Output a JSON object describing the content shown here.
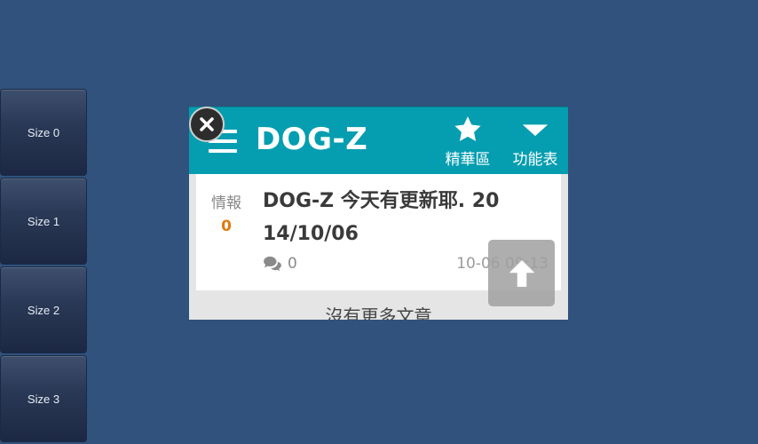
{
  "size_panel": {
    "items": [
      {
        "label": "Size 0"
      },
      {
        "label": "Size 1"
      },
      {
        "label": "Size 2"
      },
      {
        "label": "Size 3"
      }
    ]
  },
  "widget": {
    "title": "DOG-Z",
    "actions": [
      {
        "label": "精華區",
        "icon": "star-icon"
      },
      {
        "label": "功能表",
        "icon": "chevron-down-icon"
      }
    ],
    "post": {
      "category": "情報",
      "category_count": "0",
      "title_line1": "DOG-Z 今天有更新耶. 20",
      "title_line2": "14/10/06",
      "comment_count": "0",
      "date": "10-06 09:13"
    },
    "footer_text": "沒有更多文章"
  },
  "colors": {
    "background": "#30527d",
    "topbar": "#049eb0",
    "category_count": "#e07a10"
  }
}
